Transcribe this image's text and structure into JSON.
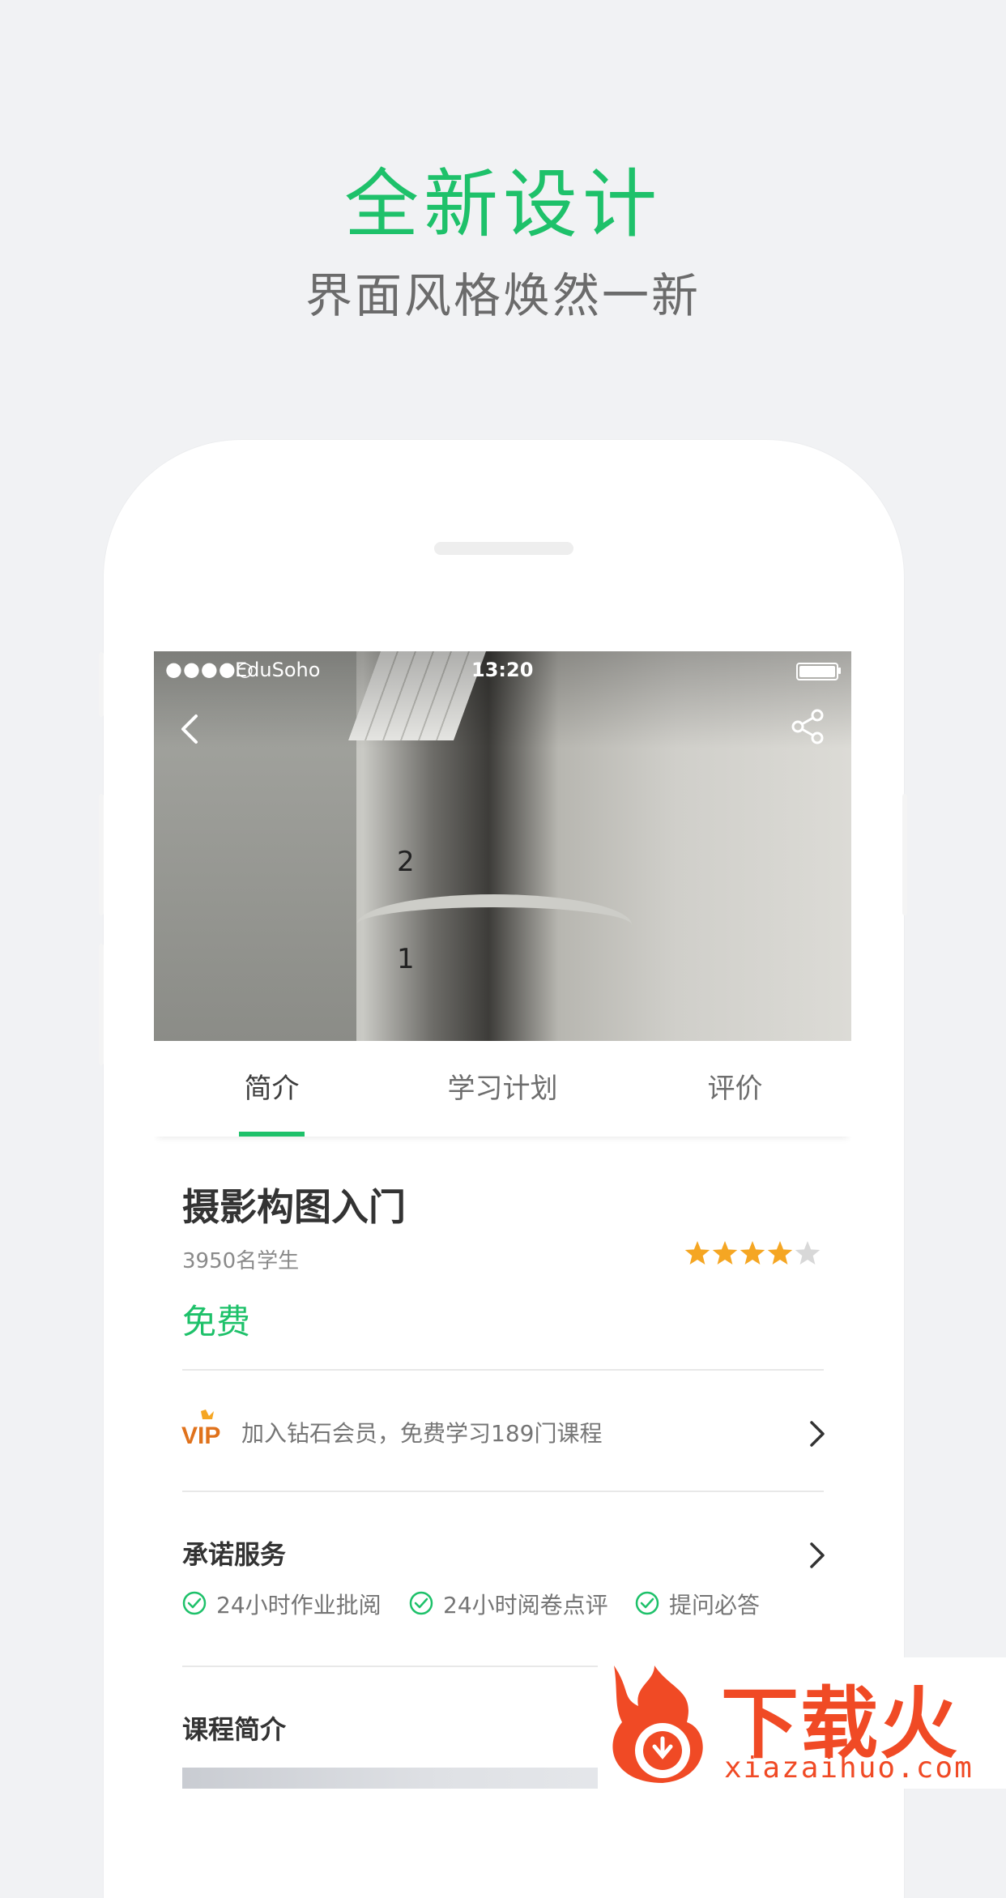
{
  "promo": {
    "headline": "全新设计",
    "subheadline": "界面风格焕然一新"
  },
  "status_bar": {
    "signal": "●●●●○",
    "carrier": "EduSoho",
    "time": "13:20"
  },
  "tabs": [
    {
      "label": "简介",
      "active": true
    },
    {
      "label": "学习计划",
      "active": false
    },
    {
      "label": "评价",
      "active": false
    }
  ],
  "course": {
    "title": "摄影构图入门",
    "students": "3950名学生",
    "rating": 4,
    "rating_max": 5,
    "price": "免费"
  },
  "hero_signs": {
    "floor_upper": "2",
    "floor_lower": "1"
  },
  "vip": {
    "icon_text": "VIP",
    "text": "加入钻石会员，免费学习189门课程"
  },
  "promise": {
    "title": "承诺服务",
    "items": [
      "24小时作业批阅",
      "24小时阅卷点评",
      "提问必答"
    ]
  },
  "intro": {
    "title": "课程简介"
  },
  "watermark": {
    "text": "下载火",
    "url": "xiazaihuo.com"
  },
  "colors": {
    "accent": "#1ec16a",
    "star": "#f5a623",
    "star_empty": "#d8d8d8",
    "watermark": "#f04a25"
  }
}
